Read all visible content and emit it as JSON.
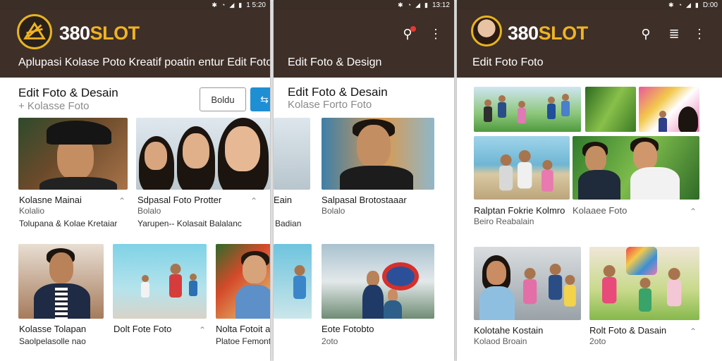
{
  "status": {
    "time_left": "1 5:20",
    "time_middle": "13:12",
    "time_right": "D:00"
  },
  "colors": {
    "appbar": "#3e2f28",
    "accent_gold": "#f0b323",
    "blue_button": "#1f8fd4"
  },
  "screen1": {
    "brand": "380SLOT",
    "subtitle": "Aplupasi Kolase Poto Kreatif poatin entur Edit Foto",
    "section_title": "Edit Foto & Desain",
    "section_subtitle": "+ Kolasse Foto",
    "button_outline": "Boldu",
    "button_blue_icon": "share-icon",
    "cards": [
      {
        "title": "Kolasne Mainai",
        "sub1": "Kolalio",
        "sub2": "Tolupana & Kolae Kretaiar"
      },
      {
        "title": "Sdpasal Foto Protter",
        "sub1": "Bolalo",
        "sub2": "Yarupen-- Kolasait Balalanc"
      },
      {
        "title": "Kolasse Tolapan",
        "sub1": "Saolpelasolle nao"
      },
      {
        "title": "Dolt Fote Foto"
      },
      {
        "title": "Nolta Fotoit anaka",
        "sub1": "Platoe Femonto"
      }
    ]
  },
  "screen2": {
    "section_title": "Edit Foto & Desain",
    "section_subtitle": "Kolase Forto Foto",
    "header_label": "Edit Foto & Design",
    "partial_left": [
      "Eain",
      "Badian"
    ],
    "cards": [
      {
        "title": "Salpasal Brotostaaar",
        "sub1": "Bolalo"
      },
      {
        "title": "Eote Fotobto",
        "sub1": "2oto"
      }
    ]
  },
  "screen3": {
    "brand": "380SLOT",
    "header_label": "Edit Foto Foto",
    "cards": [
      {
        "title": "Ralptan Fokrie Kolmro",
        "sub1": "Beiro Reabalain"
      },
      {
        "title": "Kolaaee Foto"
      },
      {
        "title": "Kolotahe Kostain",
        "sub1": "Kolaod Broain"
      },
      {
        "title": "Rolt Foto & Dasain",
        "sub1": "2oto"
      }
    ]
  }
}
